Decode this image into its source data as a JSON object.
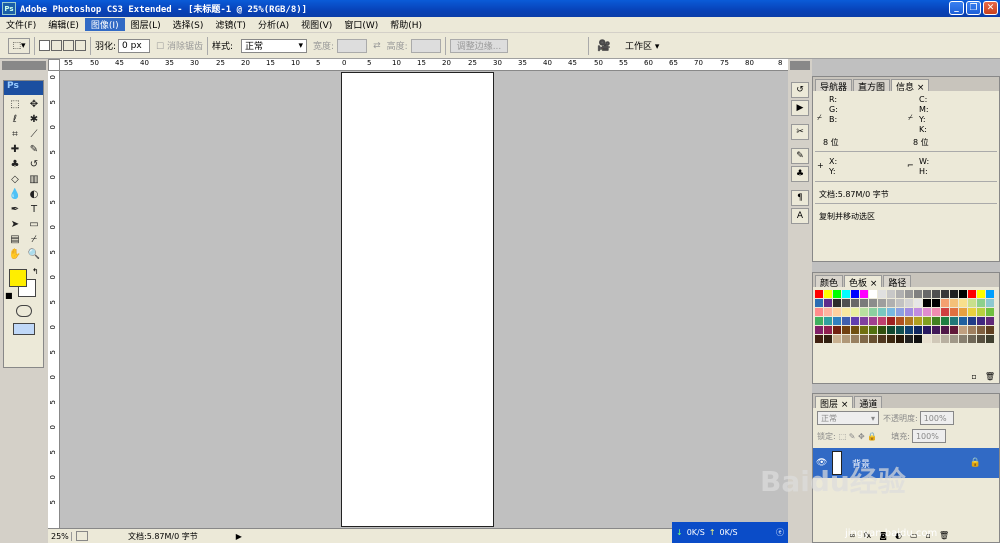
{
  "title": "Adobe Photoshop CS3 Extended - [未标题-1 @ 25%(RGB/8)]",
  "menu": [
    "文件(F)",
    "编辑(E)",
    "图像(I)",
    "图层(L)",
    "选择(S)",
    "滤镜(T)",
    "分析(A)",
    "视图(V)",
    "窗口(W)",
    "帮助(H)"
  ],
  "active_menu": 2,
  "options": {
    "feather_label": "羽化:",
    "feather_value": "0 px",
    "antialias": "消除锯齿",
    "style_label": "样式:",
    "style_value": "正常",
    "width_label": "宽度:",
    "height_label": "高度:",
    "refine": "调整边缘...",
    "workspace": "工作区 ▾"
  },
  "ruler_top": [
    "55",
    "50",
    "45",
    "40",
    "35",
    "30",
    "25",
    "20",
    "15",
    "10",
    "5",
    "0",
    "5",
    "10",
    "15",
    "20",
    "25",
    "30",
    "35",
    "40",
    "45",
    "50",
    "55",
    "60",
    "65",
    "70",
    "75",
    "80",
    "8"
  ],
  "ruler_left": [
    "0",
    "5",
    "0",
    "5",
    "0",
    "5",
    "0",
    "5",
    "0",
    "5",
    "0",
    "5",
    "0",
    "5",
    "0",
    "5",
    "0",
    "5"
  ],
  "status": {
    "zoom": "25%",
    "doc": "文档:5.87M/0 字节"
  },
  "nav_panel": {
    "tabs": [
      "导航器",
      "直方图",
      "信息 ×"
    ],
    "r": "R:",
    "g": "G:",
    "b": "B:",
    "c": "C:",
    "m": "M:",
    "y": "Y:",
    "k": "K:",
    "bit1": "8 位",
    "bit2": "8 位",
    "x": "X:",
    "yy": "Y:",
    "w": "W:",
    "h": "H:",
    "doc": "文档:5.87M/0 字节",
    "hint": "复制并移动选区"
  },
  "color_panel": {
    "tabs": [
      "颜色",
      "色板 ×",
      "路径"
    ]
  },
  "layers_panel": {
    "tabs": [
      "图层 ×",
      "通道"
    ],
    "blend": "正常",
    "opacity_label": "不透明度:",
    "opacity": "100%",
    "lock": "锁定:",
    "fill_label": "填充:",
    "fill": "100%",
    "layer_name": "背景"
  },
  "taskbar": {
    "down": "0K/S",
    "up": "0K/S"
  },
  "watermark": "Baidu经验",
  "watermark_url": "jingyan.baidu.com",
  "swatch_colors": [
    "#ff0000",
    "#ffff00",
    "#00ff00",
    "#00ffff",
    "#0000ff",
    "#ff00ff",
    "#ffffff",
    "#e0e0e0",
    "#c8c8c8",
    "#b0b0b0",
    "#989898",
    "#808080",
    "#686868",
    "#505050",
    "#383838",
    "#202020",
    "#000000",
    "#ff0000",
    "#ffff00",
    "#00a0ff",
    "#2c6eb4",
    "#5e2c8c",
    "#2c2c2c",
    "#505050",
    "#686868",
    "#7a7a7a",
    "#8c8c8c",
    "#9e9e9e",
    "#b0b0b0",
    "#c2c2c2",
    "#d4d4d4",
    "#e6e6e6",
    "#000000",
    "#000000",
    "#f4a070",
    "#f4c078",
    "#f8e08c",
    "#c8e08c",
    "#8cd08c",
    "#8cc8d0",
    "#ff8c8c",
    "#ffb4a0",
    "#ffd0a0",
    "#f8e8a0",
    "#e8f0a0",
    "#b8e0a0",
    "#8cd0a0",
    "#78c8c0",
    "#78b8e0",
    "#8ca0e0",
    "#a08ce0",
    "#c08ce0",
    "#e08cd0",
    "#f08cb0",
    "#d04040",
    "#e07040",
    "#e8a040",
    "#e8d040",
    "#b8d040",
    "#70c040",
    "#40b060",
    "#30a0a0",
    "#3080c0",
    "#4060b0",
    "#6040b0",
    "#8040a0",
    "#a04090",
    "#c04070",
    "#a02020",
    "#b05020",
    "#b07820",
    "#b0a020",
    "#80a020",
    "#408020",
    "#208040",
    "#207878",
    "#2060a0",
    "#203c88",
    "#402880",
    "#602878",
    "#802068",
    "#902050",
    "#702010",
    "#704010",
    "#705010",
    "#707010",
    "#507010",
    "#305010",
    "#104830",
    "#105050",
    "#104070",
    "#102860",
    "#281860",
    "#401858",
    "#501848",
    "#601838",
    "#c0a080",
    "#a08060",
    "#806040",
    "#604020",
    "#402010",
    "#302010",
    "#c8b090",
    "#b09878",
    "#988060",
    "#806848",
    "#685030",
    "#503820",
    "#3c2810",
    "#281808",
    "#202020",
    "#101010",
    "#e8e0d0",
    "#d0c8b8",
    "#b8b0a0",
    "#a09888",
    "#888070",
    "#706858",
    "#585040",
    "#404030"
  ]
}
